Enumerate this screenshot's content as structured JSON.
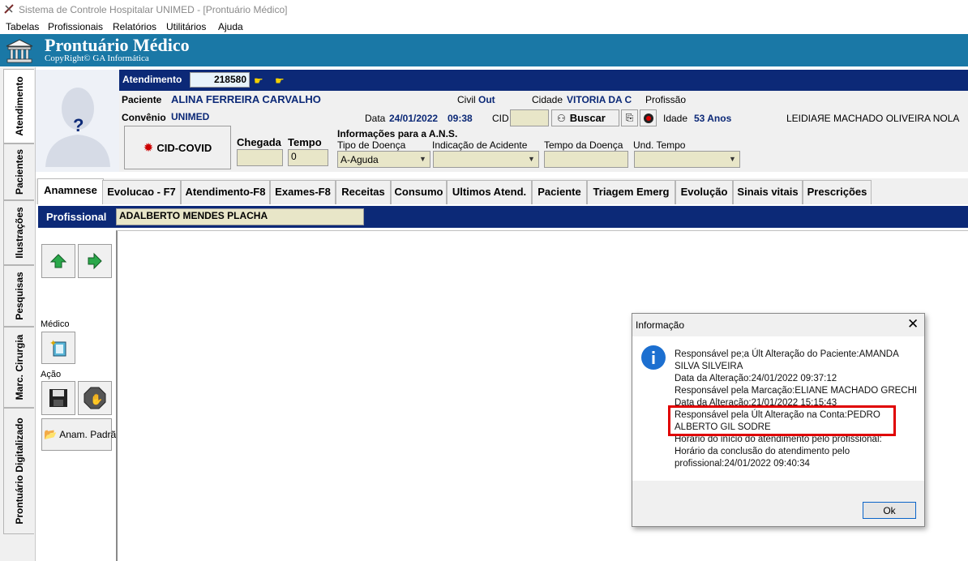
{
  "window": {
    "title": "Sistema de Controle Hospitalar UNIMED - [Prontuário Médico]"
  },
  "menu": [
    "Tabelas",
    "Profissionais",
    "Relatórios",
    "Utilitários",
    "Ajuda"
  ],
  "banner": {
    "title": "Prontuário Médico",
    "copyright": "CopyRight© GA Informática"
  },
  "side_tabs": [
    "Atendimento",
    "Pacientes",
    "Ilustrações",
    "Pesquisas",
    "Marc. Cirurgia",
    "Prontuário Digitalizado"
  ],
  "header": {
    "atendimento_label": "Atendimento",
    "atendimento_value": "218580",
    "paciente_label": "Paciente",
    "paciente_value": "ALINA FERREIRA CARVALHO",
    "civil_label": "Civil",
    "civil_value": "Out",
    "cidade_label": "Cidade",
    "cidade_value": "VITORIA DA C",
    "profissao_label": "Profissão",
    "convenio_label": "Convênio",
    "convenio_value": "UNIMED",
    "data_label": "Data",
    "data_value": "24/01/2022",
    "hora_value": "09:38",
    "cid_label": "CID",
    "buscar_label": "Buscar",
    "idade_label": "Idade",
    "idade_value": "53 Anos",
    "medico_overlap": "LEIDIAЯE MACHADO OLIVEIRA NOLA",
    "cid_covid_label": "CID-COVID",
    "chegada_label": "Chegada",
    "tempo_label": "Tempo",
    "tempo_value": "0",
    "ans_title": "Informações para a A.N.S.",
    "tipo_doenca_label": "Tipo de Doença",
    "tipo_doenca_value": "A-Aguda",
    "indicacao_label": "Indicação de Acidente",
    "tempo_doenca_label": "Tempo da Doença",
    "und_tempo_label": "Und. Tempo"
  },
  "tabs": [
    "Anamnese",
    "Evolucao - F7",
    "Atendimento-F8",
    "Exames-F8",
    "Receitas",
    "Consumo",
    "Ultimos Atend.",
    "Paciente",
    "Triagem Emerg",
    "Evolução",
    "Sinais vitais",
    "Prescrições"
  ],
  "profissional": {
    "label": "Profissional",
    "value": "ADALBERTO MENDES PLACHA"
  },
  "left_panel": {
    "medico_label": "Médico",
    "acao_label": "Ação",
    "anam_padrao_label": "Anam. Padrã"
  },
  "dialog": {
    "title": "Informação",
    "lines": [
      "Responsável pe;a Últ Alteração do Paciente:AMANDA",
      "SILVA SILVEIRA",
      "Data da Alteração:24/01/2022 09:37:12",
      "Responsável pela Marcação:ELIANE MACHADO GRECHI",
      "Data da Alteração:21/01/2022 15:15:43",
      "Responsável pela Últ Alteração na Conta:PEDRO",
      "ALBERTO GIL SODRE",
      "Horário do início do atendimento pelo profissional:",
      "Horário da conclusão do atendimento pelo",
      "profissional:24/01/2022 09:40:34"
    ],
    "ok_label": "Ok",
    "highlight_color": "#e00000"
  }
}
